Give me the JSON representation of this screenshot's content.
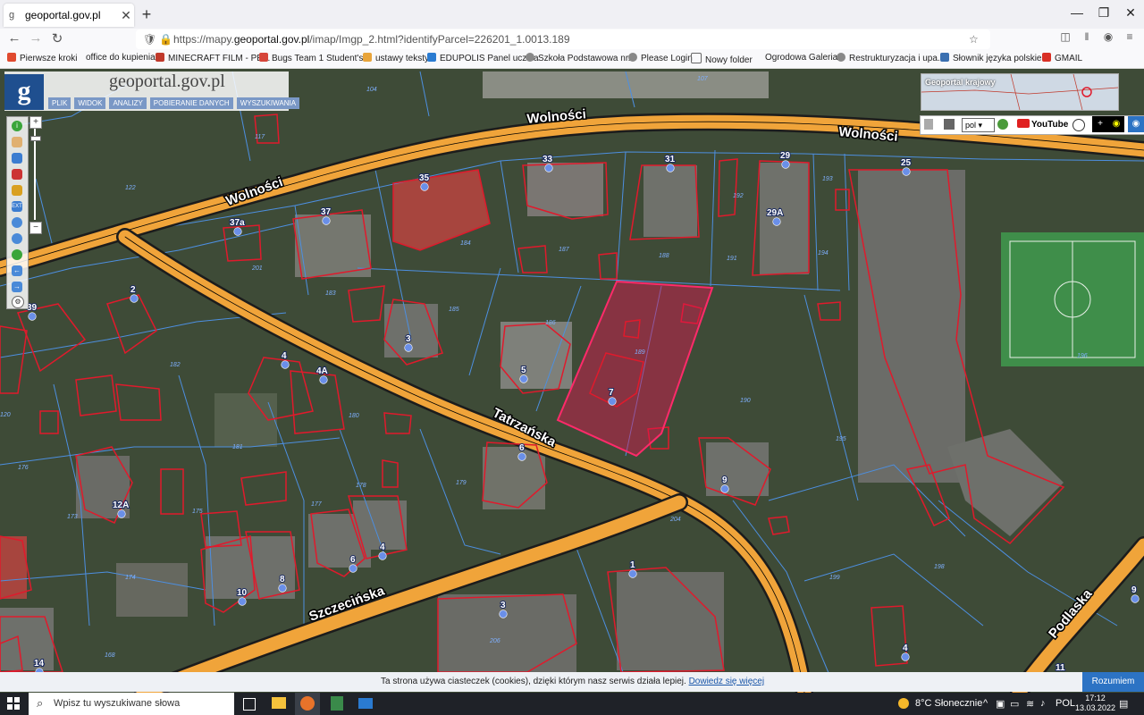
{
  "browser": {
    "tab_title": "geoportal.gov.pl",
    "url_prefix": "https://mapy.",
    "url_domain": "geoportal.gov.pl",
    "url_path": "/imap/Imgp_2.html?identifyParcel=226201_1.0013.189",
    "bookmarks": [
      {
        "label": "Pierwsze kroki",
        "color": "#e04a2f"
      },
      {
        "label": "office do kupienia",
        "color": "#ffffff"
      },
      {
        "label": "MINECRAFT FILM - PE...",
        "color": "#c0392b"
      },
      {
        "label": "Bugs Team 1 Student's...",
        "color": "#d6453a"
      },
      {
        "label": "ustawy teksty",
        "color": "#e8a43a"
      },
      {
        "label": "EDUPOLIS Panel ucznia",
        "color": "#2a7bd1"
      },
      {
        "label": "Szkoła Podstawowa nr...",
        "color": "#888888"
      },
      {
        "label": "Please Login",
        "color": "#888888"
      },
      {
        "label": "Nowy folder",
        "color": "#888888"
      },
      {
        "label": "Ogrodowa Galeria",
        "color": "#ffffff"
      },
      {
        "label": "Restrukturyzacja i upa...",
        "color": "#888888"
      },
      {
        "label": "Słownik języka polskie...",
        "color": "#3a6fb0"
      },
      {
        "label": "GMAIL",
        "color": "#d93025"
      }
    ]
  },
  "geoportal": {
    "logo_letter": "g",
    "logo_text": "geoportal.gov.pl",
    "menu": [
      "PLIK",
      "WIDOK",
      "ANALIZY",
      "POBIERANIE DANYCH",
      "WYSZUKIWANIA"
    ],
    "overview_title": "Geoportal krajowy",
    "language": "pol",
    "youtube_label": "YouTube",
    "zoom_in": "+",
    "zoom_out": "−"
  },
  "map": {
    "streets": {
      "wolnosci_1": "Wolności",
      "wolnosci_2": "Wolności",
      "wolnosci_3": "Wolności",
      "tatrzanska": "Tatrzańska",
      "szczecinska": "Szczecińska",
      "podlaska": "Podlaska"
    },
    "house_numbers": [
      "33",
      "31",
      "29",
      "25",
      "35",
      "37",
      "37a",
      "29A",
      "2",
      "39",
      "3",
      "5",
      "7",
      "4",
      "4A",
      "6",
      "9",
      "12A",
      "6",
      "4",
      "10",
      "8",
      "1",
      "3",
      "14",
      "4",
      "11",
      "9"
    ],
    "parcel_numbers": [
      "184",
      "187",
      "188",
      "191",
      "192",
      "193",
      "194",
      "183",
      "185",
      "186",
      "189",
      "190",
      "182",
      "180",
      "181",
      "178",
      "179",
      "177",
      "173",
      "175",
      "174",
      "176",
      "195",
      "196",
      "198",
      "199",
      "204",
      "206",
      "168",
      "201",
      "122",
      "117",
      "104",
      "107",
      "120"
    ],
    "selected_parcel": "189"
  },
  "cookie": {
    "message": "Ta strona używa ciasteczek (cookies), dzięki którym nasz serwis działa lepiej.",
    "link": "Dowiedz się więcej",
    "accept": "Rozumiem"
  },
  "taskbar": {
    "search_placeholder": "Wpisz tu wyszukiwane słowa",
    "weather": "8°C  Słonecznie",
    "lang": "POL",
    "time": "17:12",
    "date": "13.03.2022"
  }
}
